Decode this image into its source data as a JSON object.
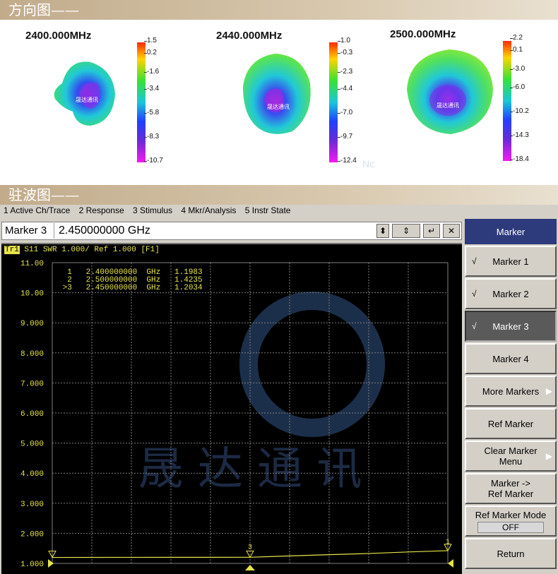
{
  "banners": {
    "pattern": "方向图——",
    "vswr": "驻波图——"
  },
  "patterns": [
    {
      "freq": "2400.000MHz",
      "ticks": [
        "1.5",
        "0.2",
        "-1.6",
        "-3.4",
        "-5.8",
        "-8.3",
        "-10.7"
      ]
    },
    {
      "freq": "2440.000MHz",
      "ticks": [
        "1.0",
        "-0.3",
        "-2.3",
        "-4.4",
        "-7.0",
        "-9.7",
        "-12.4"
      ]
    },
    {
      "freq": "2500.000MHz",
      "ticks": [
        "2.2",
        "0.1",
        "-3.0",
        "-6.0",
        "-10.2",
        "-14.3",
        "-18.4"
      ]
    }
  ],
  "pattern_watermark": "晟达通讯",
  "pattern_faint_text": "Nc",
  "menu": [
    "1 Active Ch/Trace",
    "2 Response",
    "3 Stimulus",
    "4 Mkr/Analysis",
    "5 Instr State"
  ],
  "entry": {
    "label": "Marker 3",
    "value": "2.450000000 GHz"
  },
  "screen": {
    "trace_id": "Tr1",
    "trace_title": " S11  SWR 1.000/ Ref 1.000  [F1]",
    "marker_readout": [
      "  1   2.400000000  GHz   1.1983",
      "  2   2.500000000  GHz   1.4235",
      " >3   2.450000000  GHz   1.2034"
    ],
    "watermark": "晟 达 通 讯",
    "marker_label_3": "3",
    "marker_label_1": "1"
  },
  "softkeys": {
    "header": "Marker",
    "marker1": "Marker 1",
    "marker2": "Marker 2",
    "marker3": "Marker 3",
    "marker4": "Marker 4",
    "more": "More Markers",
    "ref": "Ref Marker",
    "clear_line1": "Clear Marker",
    "clear_line2": "Menu",
    "to_ref_line1": "Marker ->",
    "to_ref_line2": "Ref Marker",
    "ref_mode": "Ref Marker Mode",
    "ref_mode_value": "OFF",
    "return": "Return",
    "check": "√"
  },
  "colors": {
    "trace": "#e7e44a",
    "grid": "#7f7f7f",
    "softkey_header": "#2d3a7c",
    "active_key": "#5a5a5a"
  },
  "chart_data": {
    "type": "line",
    "title": "S11 SWR 1.000/ Ref 1.000 [F1]",
    "xlabel": "",
    "ylabel": "",
    "ylim": [
      1.0,
      11.0
    ],
    "yticks": [
      "11.00",
      "10.00",
      "9.000",
      "8.000",
      "7.000",
      "6.000",
      "5.000",
      "4.000",
      "3.000",
      "2.000",
      "1.000"
    ],
    "x_range_ghz": [
      2.4,
      2.5
    ],
    "series": [
      {
        "x": [
          2.4,
          2.41,
          2.42,
          2.43,
          2.44,
          2.45,
          2.46,
          2.47,
          2.48,
          2.49,
          2.5
        ],
        "y": [
          1.1983,
          1.2,
          1.201,
          1.202,
          1.203,
          1.2034,
          1.25,
          1.29,
          1.33,
          1.38,
          1.4235
        ]
      }
    ],
    "markers": [
      {
        "id": "1",
        "x": 2.4,
        "y": 1.1983
      },
      {
        "id": "2",
        "x": 2.5,
        "y": 1.4235
      },
      {
        "id": "3",
        "x": 2.45,
        "y": 1.2034
      }
    ],
    "grid": true
  }
}
